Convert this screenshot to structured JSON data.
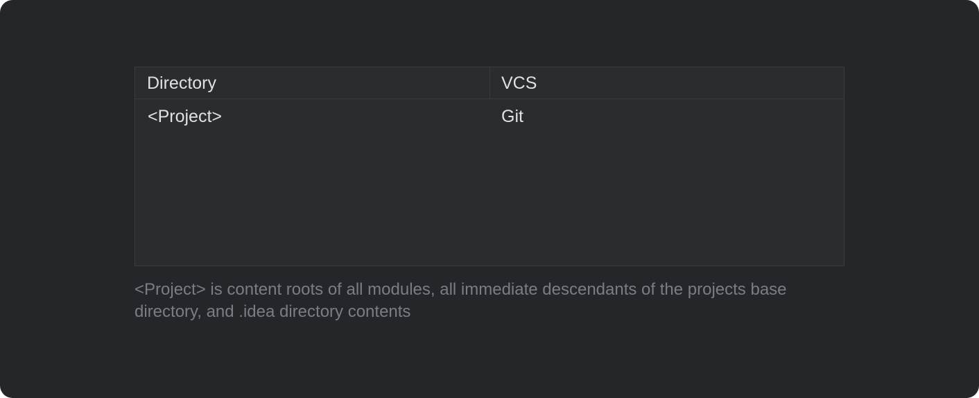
{
  "table": {
    "columns": [
      "Directory",
      "VCS"
    ],
    "rows": [
      {
        "directory": "<Project>",
        "vcs": "Git"
      }
    ]
  },
  "hint": "<Project> is content roots of all modules, all immediate descendants of the projects base directory, and .idea directory contents",
  "colors": {
    "background": "#25262a",
    "table_background": "#2b2c30",
    "border": "#3a3b3f",
    "text": "#dfe1e5",
    "hint_text": "#7b7d83"
  }
}
